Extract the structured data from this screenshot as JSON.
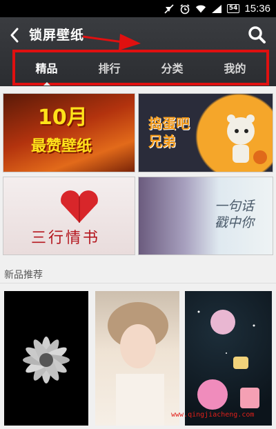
{
  "status_bar": {
    "battery": "54",
    "time": "15:36",
    "icons": [
      "mute-icon",
      "alarm-icon",
      "wifi-icon",
      "signal-icon",
      "battery-icon"
    ]
  },
  "header": {
    "title": "锁屏壁纸",
    "back_icon": "chevron-left-icon",
    "search_icon": "search-icon"
  },
  "tabs": [
    {
      "label": "精品",
      "active": true
    },
    {
      "label": "排行",
      "active": false
    },
    {
      "label": "分类",
      "active": false
    },
    {
      "label": "我的",
      "active": false
    }
  ],
  "featured": [
    {
      "line1": "10月",
      "line2": "最赞壁纸"
    },
    {
      "line1": "捣蛋吧",
      "line2": "兄弟"
    },
    {
      "text": "三行情书"
    },
    {
      "line1": "一句话",
      "line2": "戳中你"
    }
  ],
  "new_section": {
    "title": "新品推荐"
  },
  "watermark": "www.qingjiacheng.com",
  "colors": {
    "header_bg": "#2b2d31",
    "annotation_red": "#e01010"
  }
}
